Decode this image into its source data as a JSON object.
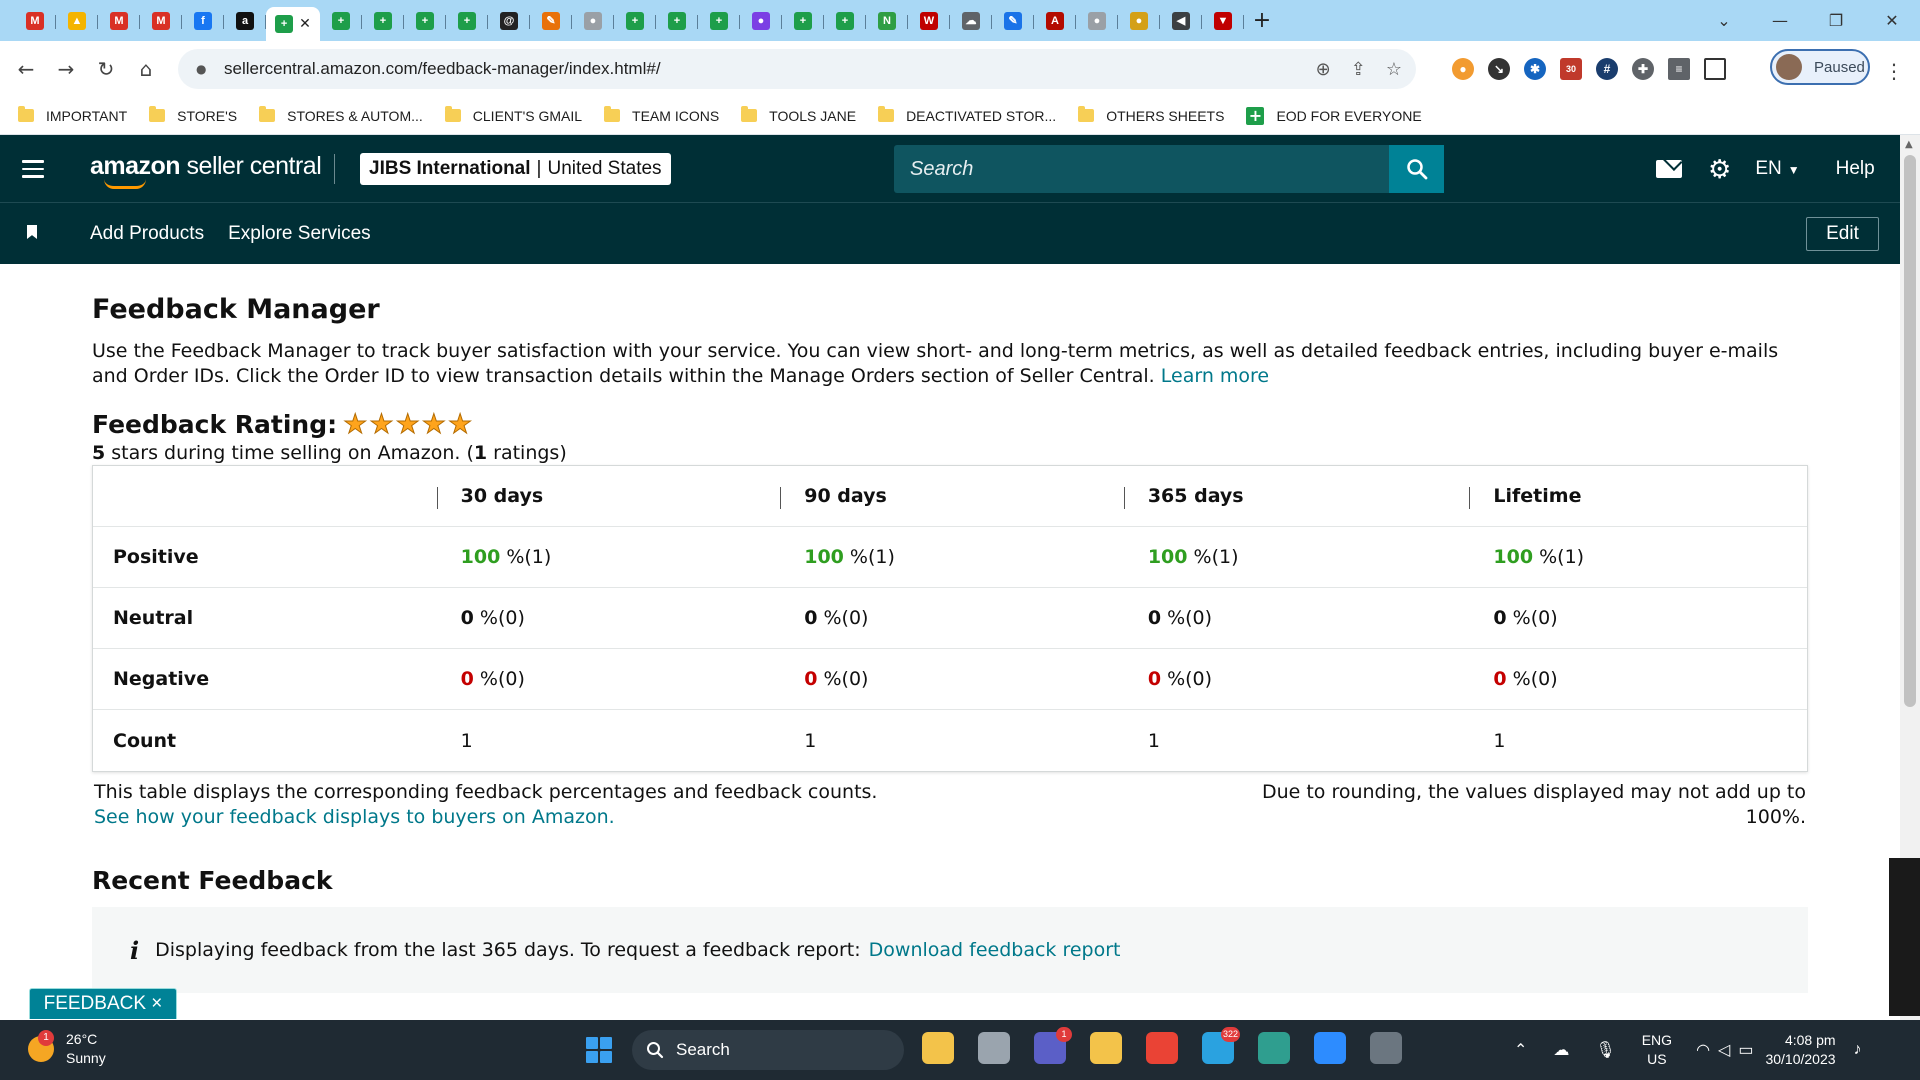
{
  "browser": {
    "tabs": [
      {
        "icon": "gmail-icon",
        "color": "#d93025",
        "glyph": "M"
      },
      {
        "icon": "drive-icon",
        "color": "#f4b400",
        "glyph": "▲"
      },
      {
        "icon": "gmail-icon",
        "color": "#d93025",
        "glyph": "M"
      },
      {
        "icon": "gmail-icon",
        "color": "#d93025",
        "glyph": "M"
      },
      {
        "icon": "facebook-icon",
        "color": "#1877f2",
        "glyph": "f"
      },
      {
        "icon": "amazon-icon",
        "color": "#111111",
        "glyph": "a"
      },
      {
        "icon": "sheets-icon",
        "color": "#1e9e4a",
        "glyph": "+"
      },
      {
        "icon": "sheets-icon",
        "color": "#1e9e4a",
        "glyph": "+"
      },
      {
        "icon": "sheets-icon",
        "color": "#1e9e4a",
        "glyph": "+"
      },
      {
        "icon": "sheets-icon",
        "color": "#1e9e4a",
        "glyph": "+"
      },
      {
        "icon": "sheets-icon",
        "color": "#1e9e4a",
        "glyph": "+"
      },
      {
        "icon": "threads-icon",
        "color": "#222222",
        "glyph": "@"
      },
      {
        "icon": "pen-icon",
        "color": "#e8710a",
        "glyph": "✎"
      },
      {
        "icon": "globe-icon",
        "color": "#9aa0a6",
        "glyph": "●"
      },
      {
        "icon": "sheets-icon",
        "color": "#1e9e4a",
        "glyph": "+"
      },
      {
        "icon": "sheets-icon",
        "color": "#1e9e4a",
        "glyph": "+"
      },
      {
        "icon": "sheets-icon",
        "color": "#1e9e4a",
        "glyph": "+"
      },
      {
        "icon": "chat-icon",
        "color": "#7b3fe4",
        "glyph": "●"
      },
      {
        "icon": "sheets-icon",
        "color": "#1e9e4a",
        "glyph": "+"
      },
      {
        "icon": "sheets-icon",
        "color": "#1e9e4a",
        "glyph": "+"
      },
      {
        "icon": "n-app-icon",
        "color": "#2f9e44",
        "glyph": "N"
      },
      {
        "icon": "ww-icon",
        "color": "#c00000",
        "glyph": "W"
      },
      {
        "icon": "cloud-icon",
        "color": "#5f6368",
        "glyph": "☁"
      },
      {
        "icon": "edit-icon",
        "color": "#1a73e8",
        "glyph": "✎"
      },
      {
        "icon": "acrobat-icon",
        "color": "#b30b00",
        "glyph": "A"
      },
      {
        "icon": "globe-icon",
        "color": "#9aa0a6",
        "glyph": "●"
      },
      {
        "icon": "coin-icon",
        "color": "#d4a017",
        "glyph": "●"
      },
      {
        "icon": "audio-icon",
        "color": "#3c4043",
        "glyph": "◀"
      },
      {
        "icon": "vpn-icon",
        "color": "#c00000",
        "glyph": "▼"
      }
    ],
    "active_tab_index": 6,
    "url": "sellercentral.amazon.com/feedback-manager/index.html#/",
    "profile_label": "Paused",
    "ext_badge": "30",
    "bookmarks": [
      {
        "label": "IMPORTANT",
        "type": "folder"
      },
      {
        "label": "STORE'S",
        "type": "folder"
      },
      {
        "label": "STORES & AUTOM...",
        "type": "folder"
      },
      {
        "label": "CLIENT'S GMAIL",
        "type": "folder"
      },
      {
        "label": "TEAM ICONS",
        "type": "folder"
      },
      {
        "label": "TOOLS JANE",
        "type": "folder"
      },
      {
        "label": "DEACTIVATED STOR...",
        "type": "folder"
      },
      {
        "label": "OTHERS SHEETS",
        "type": "folder"
      },
      {
        "label": "EOD FOR EVERYONE",
        "type": "sheet"
      }
    ]
  },
  "header": {
    "logo_bold": "amazon",
    "logo_rest": " seller central",
    "account_name": "JIBS International",
    "account_sep": "|",
    "account_region": "United States",
    "search_placeholder": "Search",
    "lang": "EN",
    "help": "Help"
  },
  "subnav": {
    "links": [
      "Add Products",
      "Explore Services"
    ],
    "edit_label": "Edit"
  },
  "page": {
    "title": "Feedback Manager",
    "intro": "Use the Feedback Manager to track buyer satisfaction with your service. You can view short- and long-term metrics, as well as detailed feedback entries, including buyer e-mails and Order IDs. Click the Order ID to view transaction details within the Manage Orders section of Seller Central.",
    "learn_more": "Learn more",
    "rating_label": "Feedback Rating:",
    "rating_stars": 5,
    "rating_stars_value": "5",
    "rating_text_mid": " stars during time selling on Amazon. (",
    "rating_count": "1",
    "rating_text_end": " ratings)",
    "table": {
      "columns": [
        "30 days",
        "90 days",
        "365 days",
        "Lifetime"
      ],
      "rows": [
        {
          "label": "Positive",
          "tone": "green",
          "cells": [
            {
              "pct": "100",
              "rest": " %(1)"
            },
            {
              "pct": "100",
              "rest": " %(1)"
            },
            {
              "pct": "100",
              "rest": " %(1)"
            },
            {
              "pct": "100",
              "rest": " %(1)"
            }
          ]
        },
        {
          "label": "Neutral",
          "tone": "bold",
          "cells": [
            {
              "pct": "0",
              "rest": " %(0)"
            },
            {
              "pct": "0",
              "rest": " %(0)"
            },
            {
              "pct": "0",
              "rest": " %(0)"
            },
            {
              "pct": "0",
              "rest": " %(0)"
            }
          ]
        },
        {
          "label": "Negative",
          "tone": "red",
          "cells": [
            {
              "pct": "0",
              "rest": " %(0)"
            },
            {
              "pct": "0",
              "rest": " %(0)"
            },
            {
              "pct": "0",
              "rest": " %(0)"
            },
            {
              "pct": "0",
              "rest": " %(0)"
            }
          ]
        },
        {
          "label": "Count",
          "tone": "plain",
          "cells": [
            {
              "pct": "1",
              "rest": ""
            },
            {
              "pct": "1",
              "rest": ""
            },
            {
              "pct": "1",
              "rest": ""
            },
            {
              "pct": "1",
              "rest": ""
            }
          ]
        }
      ]
    },
    "note_left": "This table displays the corresponding feedback percentages and feedback counts.",
    "note_left_link": "See how your feedback displays to buyers on Amazon.",
    "note_right": "Due to rounding, the values displayed may not add up to 100%.",
    "recent_title": "Recent Feedback",
    "info_text": "Displaying feedback from the last 365 days. To request a feedback report:",
    "info_link": "Download feedback report",
    "feedback_tab": "FEEDBACK ×"
  },
  "taskbar": {
    "temp": "26°C",
    "weather": "Sunny",
    "weather_badge": "1",
    "search": "Search",
    "apps": [
      {
        "icon": "file-explorer-icon",
        "color": "#f3c34a",
        "badge": ""
      },
      {
        "icon": "window-icon",
        "color": "#9aa4ae",
        "badge": ""
      },
      {
        "icon": "teams-icon",
        "color": "#5b5fc7",
        "badge": "1"
      },
      {
        "icon": "folder-icon",
        "color": "#f3c34a",
        "badge": ""
      },
      {
        "icon": "chrome-icon",
        "color": "#ea4335",
        "badge": ""
      },
      {
        "icon": "telegram-icon",
        "color": "#2aa2e0",
        "badge": "322"
      },
      {
        "icon": "edge-icon",
        "color": "#2f9e8f",
        "badge": ""
      },
      {
        "icon": "zoom-icon",
        "color": "#2d8cff",
        "badge": ""
      },
      {
        "icon": "calculator-icon",
        "color": "#6b7680",
        "badge": ""
      }
    ],
    "lang_top": "ENG",
    "lang_bottom": "US",
    "time": "4:08 pm",
    "date": "30/10/2023"
  }
}
